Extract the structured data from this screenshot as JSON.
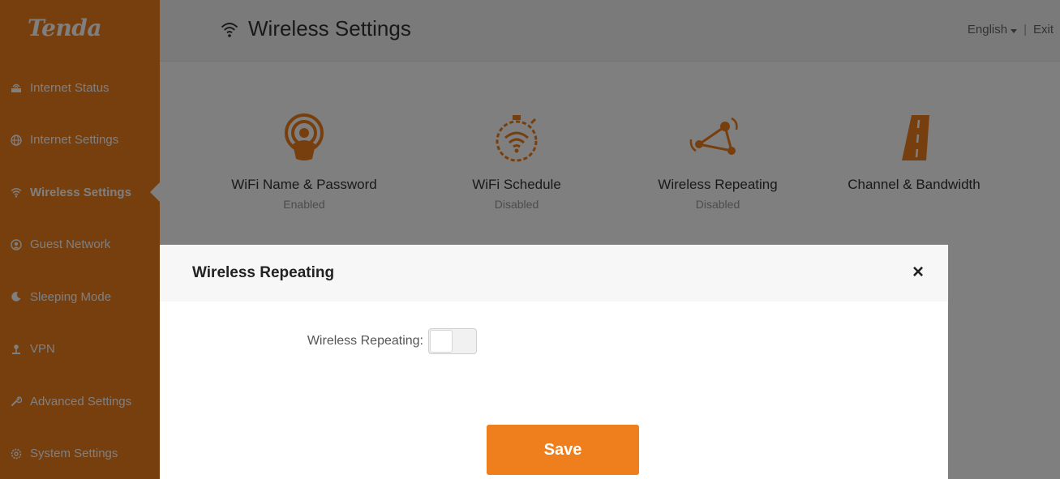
{
  "brand": {
    "logo": "Tenda",
    "accent": "#ef7f1c"
  },
  "sidebar": {
    "items": [
      {
        "label": "Internet Status",
        "icon": "router-icon",
        "active": false
      },
      {
        "label": "Internet Settings",
        "icon": "globe-icon",
        "active": false
      },
      {
        "label": "Wireless Settings",
        "icon": "wifi-icon",
        "active": true
      },
      {
        "label": "Guest Network",
        "icon": "guest-icon",
        "active": false
      },
      {
        "label": "Sleeping Mode",
        "icon": "moon-icon",
        "active": false
      },
      {
        "label": "VPN",
        "icon": "vpn-icon",
        "active": false
      },
      {
        "label": "Advanced Settings",
        "icon": "wrench-icon",
        "active": false
      },
      {
        "label": "System Settings",
        "icon": "gear-icon",
        "active": false
      }
    ]
  },
  "header": {
    "title": "Wireless Settings",
    "title_icon": "wifi-icon",
    "language": "English",
    "separator": "|",
    "exit": "Exit"
  },
  "features": [
    {
      "name": "WiFi Name & Password",
      "status": "Enabled",
      "icon": "wifi-name-icon"
    },
    {
      "name": "WiFi Schedule",
      "status": "Disabled",
      "icon": "wifi-timer-icon"
    },
    {
      "name": "Wireless Repeating",
      "status": "Disabled",
      "icon": "repeater-icon"
    },
    {
      "name": "Channel & Bandwidth",
      "status": "",
      "icon": "road-icon"
    }
  ],
  "modal": {
    "title": "Wireless Repeating",
    "close": "×",
    "field_label": "Wireless Repeating:",
    "toggle_on": false,
    "save_label": "Save"
  }
}
